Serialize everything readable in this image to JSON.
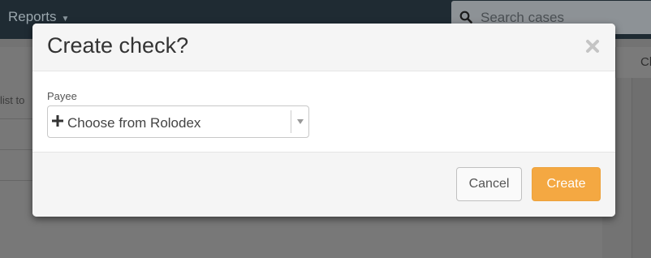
{
  "background": {
    "nav_reports_label": "Reports",
    "search_placeholder": "Search cases",
    "cut_text": "list to",
    "tab_partial": "Cl"
  },
  "modal": {
    "title": "Create check?",
    "close_icon": "close-icon",
    "payee": {
      "label": "Payee",
      "selected_value": "Choose from Rolodex",
      "icon": "plus-icon"
    },
    "buttons": {
      "cancel_label": "Cancel",
      "create_label": "Create"
    }
  },
  "colors": {
    "primary_button": "#f4a842",
    "topbar": "#1f2b33"
  }
}
